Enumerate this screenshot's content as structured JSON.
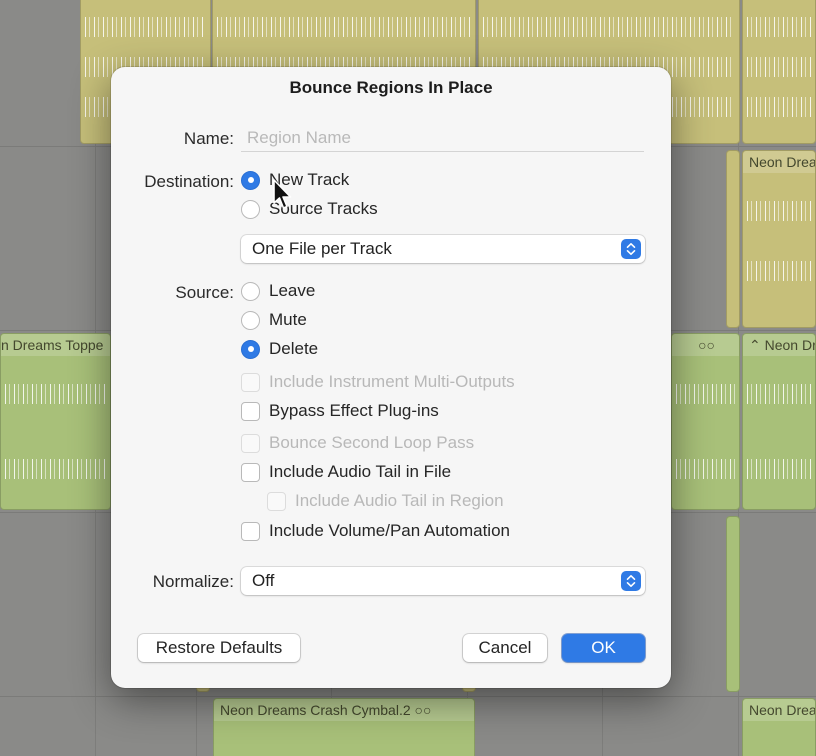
{
  "background": {
    "regions": {
      "neon_dreams_top_right": "Neon Drea",
      "neon_dreams_topper": "n Dreams Toppe",
      "neon_dreams_mid_right": "Neon Dr",
      "crash_cymbal": "Neon Dreams Crash Cymbal.2",
      "neon_dreams_bottom_right": "Neon Drea"
    }
  },
  "dialog": {
    "title": "Bounce Regions In Place",
    "name_label": "Name:",
    "name_value": "",
    "name_placeholder": "Region Name",
    "destination_label": "Destination:",
    "destination_options": {
      "new_track": "New Track",
      "source_tracks": "Source Tracks",
      "selected": "New Track"
    },
    "file_mode": "One File per Track",
    "source_label": "Source:",
    "source_options": {
      "leave": "Leave",
      "mute": "Mute",
      "delete": "Delete",
      "selected": "Delete"
    },
    "checkboxes": {
      "include_instrument_multi_outputs": "Include Instrument Multi-Outputs",
      "bypass_effect_plugins": "Bypass Effect Plug-ins",
      "bounce_second_loop_pass": "Bounce Second Loop Pass",
      "include_audio_tail_in_file": "Include Audio Tail in File",
      "include_audio_tail_in_region": "Include Audio Tail in Region",
      "include_volume_pan_automation": "Include Volume/Pan Automation"
    },
    "normalize_label": "Normalize:",
    "normalize_value": "Off",
    "buttons": {
      "restore_defaults": "Restore Defaults",
      "cancel": "Cancel",
      "ok": "OK"
    },
    "colors": {
      "accent": "#2f7ae5"
    }
  }
}
